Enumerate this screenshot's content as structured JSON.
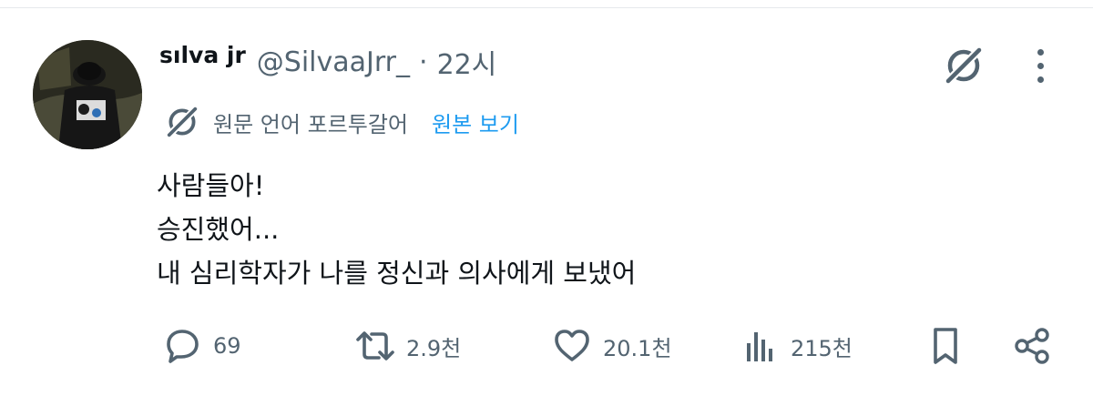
{
  "tweet": {
    "display_name": "sılva jr",
    "handle": "@SilvaaJrr_",
    "separator": "·",
    "time": "22시",
    "translation": {
      "label": "원문 언어 포르투갈어",
      "show_original": "원본 보기"
    },
    "text_lines": [
      "사람들아!",
      "승진했어...",
      "내 심리학자가 나를 정신과 의사에게 보냈어"
    ]
  },
  "actions": {
    "replies": "69",
    "retweets": "2.9천",
    "likes": "20.1천",
    "views": "215천"
  },
  "icons": {
    "grok": "grok-icon",
    "more": "more-vertical-icon",
    "translate": "grok-translate-icon",
    "reply": "reply-bubble-icon",
    "retweet": "retweet-icon",
    "like": "heart-icon",
    "views": "views-bar-chart-icon",
    "bookmark": "bookmark-icon",
    "share": "share-icon"
  },
  "colors": {
    "text": "#0f1419",
    "secondary": "#536471",
    "link": "#1d9bf0"
  }
}
